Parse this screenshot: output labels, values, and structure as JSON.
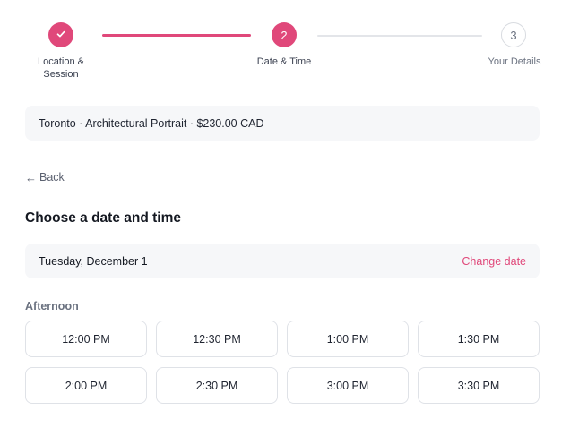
{
  "stepper": {
    "steps": [
      {
        "number": "",
        "label": "Location &\nSession",
        "state": "completed",
        "icon": "check-icon"
      },
      {
        "number": "2",
        "label": "Date & Time",
        "state": "current"
      },
      {
        "number": "3",
        "label": "Your Details",
        "state": "upcoming"
      }
    ]
  },
  "summary": {
    "text": "Toronto · Architectural Portrait · $230.00 CAD"
  },
  "back": {
    "arrow": "←",
    "label": "Back"
  },
  "heading": "Choose a date and time",
  "selected_date": {
    "date": "Tuesday, December 1",
    "change_label": "Change date"
  },
  "section": {
    "label": "Afternoon"
  },
  "slots": [
    "12:00 PM",
    "12:30 PM",
    "1:00 PM",
    "1:30 PM",
    "2:00 PM",
    "2:30 PM",
    "3:00 PM",
    "3:30 PM"
  ],
  "colors": {
    "accent": "#e0487a",
    "muted_text": "#6b7280",
    "panel_bg": "#f6f7f9",
    "border": "#dfe2e7"
  }
}
